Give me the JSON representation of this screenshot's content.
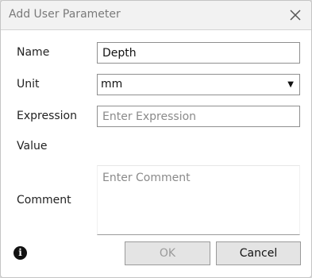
{
  "dialog": {
    "title": "Add User Parameter"
  },
  "form": {
    "name_label": "Name",
    "name_value": "Depth",
    "unit_label": "Unit",
    "unit_value": "mm",
    "expression_label": "Expression",
    "expression_placeholder": "Enter Expression",
    "value_label": "Value",
    "comment_label": "Comment",
    "comment_placeholder": "Enter Comment"
  },
  "buttons": {
    "ok_label": "OK",
    "cancel_label": "Cancel"
  },
  "icons": {
    "close": "close-icon",
    "dropdown": "chevron-down-icon",
    "info": "info-icon"
  },
  "info_glyph": "i"
}
